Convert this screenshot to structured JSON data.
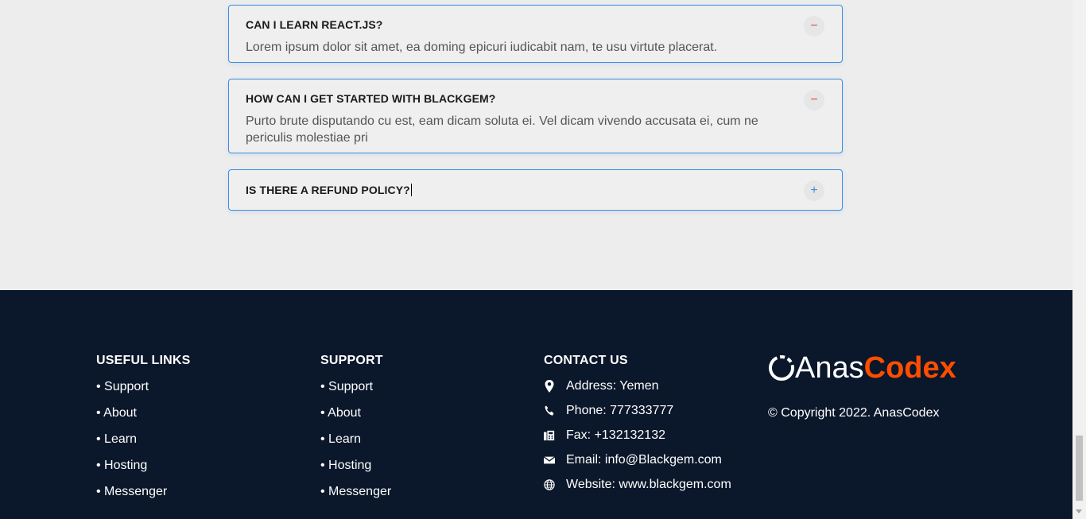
{
  "faq": [
    {
      "question": "CAN I LEARN REACT.JS?",
      "answer": "Lorem ipsum dolor sit amet, ea doming epicuri iudicabit nam, te usu virtute placerat.",
      "state": "minus"
    },
    {
      "question": "HOW CAN I GET STARTED WITH BLACKGEM?",
      "answer": "Purto brute disputando cu est, eam dicam soluta ei. Vel dicam vivendo accusata ei, cum ne periculis molestiae pri",
      "state": "minus"
    },
    {
      "question": "IS THERE A REFUND POLICY?",
      "answer": "",
      "state": "plus"
    }
  ],
  "footer": {
    "useful_links": {
      "title": "USEFUL LINKS",
      "items": [
        "• Support",
        "• About",
        "• Learn",
        "• Hosting",
        "• Messenger"
      ]
    },
    "support": {
      "title": "SUPPORT",
      "items": [
        "• Support",
        "• About",
        "• Learn",
        "• Hosting",
        "• Messenger"
      ]
    },
    "contact": {
      "title": "CONTACT US",
      "address": "Address: Yemen",
      "phone": "Phone: 777333777",
      "fax": "Fax: +132132132",
      "email": "Email: info@Blackgem.com",
      "website": "Website: www.blackgem.com"
    },
    "brand": {
      "logo_part1": "Anas",
      "logo_part2": "Codex",
      "copyright": "© Copyright 2022. AnasCodex"
    }
  },
  "colors": {
    "footer_bg": "#0b172b",
    "accent": "#3c8ce0",
    "brand_orange": "#ff4d00",
    "minus_red": "#e04848"
  }
}
